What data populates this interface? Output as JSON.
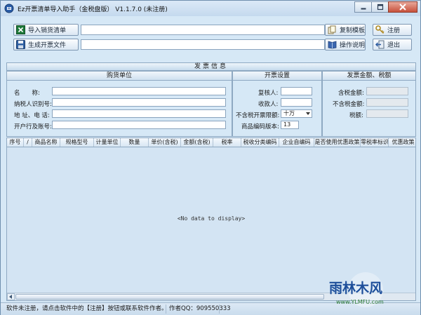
{
  "window": {
    "title": "Ez开票清单导入助手（金税盘版） V1.1.7.0 (未注册)"
  },
  "toolbar": {
    "import_label": "导入销货清单",
    "generate_label": "生成开票文件",
    "copy_template_label": "复制模板",
    "register_label": "注册",
    "help_label": "操作说明",
    "exit_label": "退出",
    "import_path": "",
    "output_path": ""
  },
  "section_title": "发票信息",
  "buyer": {
    "title": "购货单位",
    "name_label": "名　　称:",
    "taxid_label": "纳税人识别号:",
    "address_label": "地 址、电 话:",
    "bank_label": "开户行及账号:",
    "name_value": "",
    "taxid_value": "",
    "address_value": "",
    "bank_value": ""
  },
  "invoice_settings": {
    "title": "开票设置",
    "reviewer_label": "复核人:",
    "payee_label": "收款人:",
    "limit_label": "不含税开票限额:",
    "version_label": "商品编码版本:",
    "reviewer_value": "",
    "payee_value": "",
    "limit_value": "十万",
    "version_value": "13"
  },
  "amounts": {
    "title": "发票金额、税额",
    "with_tax_label": "含税金额:",
    "without_tax_label": "不含税金额:",
    "tax_label": "税额:",
    "with_tax_value": "",
    "without_tax_value": "",
    "tax_value": ""
  },
  "grid": {
    "columns": [
      "序号",
      "/",
      "商品名称",
      "规格型号",
      "计量单位",
      "数量",
      "单价(含税)",
      "金额(含税)",
      "税率",
      "税收分类编码",
      "企业自编码",
      "是否使用优惠政策",
      "零税率标识",
      "优惠政策"
    ],
    "empty_text": "<No data to display>"
  },
  "status": {
    "message": "软件未注册，请点击软件中的【注册】按钮或联系软件作者。",
    "author_label": "作者QQ：",
    "author_qq": "909550333"
  },
  "watermark": {
    "brand": "雨林木风",
    "url": "www.YLMFU.com"
  },
  "colors": {
    "window_bg": "#d6e8f6",
    "border": "#8fa9c2",
    "close_button": "#c7503b"
  }
}
